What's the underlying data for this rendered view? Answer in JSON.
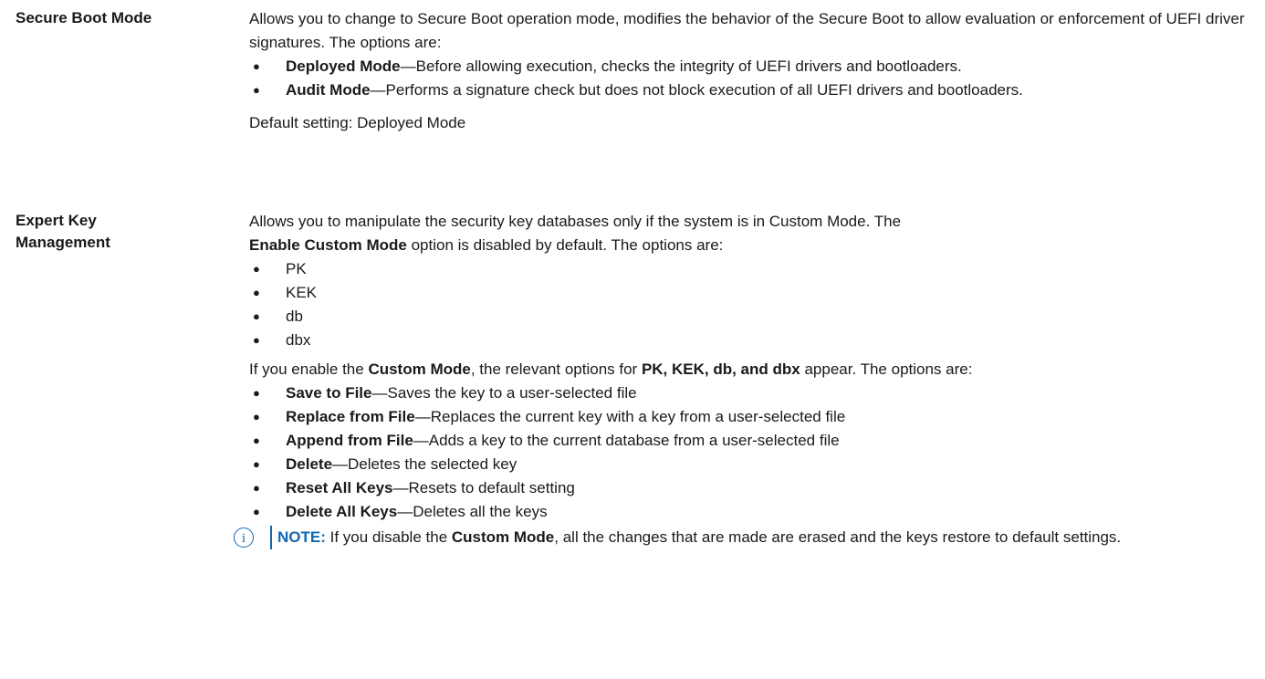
{
  "secure_boot": {
    "term": "Secure Boot Mode",
    "intro": "Allows you to change to Secure Boot operation mode, modifies the behavior of the Secure Boot to allow evaluation or enforcement of UEFI driver signatures. The options are:",
    "options": [
      {
        "name": "Deployed Mode",
        "desc": "—Before allowing execution, checks the integrity of UEFI drivers and bootloaders."
      },
      {
        "name": "Audit Mode",
        "desc": "—Performs a signature check but does not block execution of all UEFI drivers and bootloaders."
      }
    ],
    "default": "Default setting: Deployed Mode"
  },
  "expert_key": {
    "term_line1": "Expert Key",
    "term_line2": "Management",
    "intro_1": "Allows you to manipulate the security key databases only if the system is in Custom Mode. The",
    "intro_bold": "Enable Custom Mode",
    "intro_2": " option is disabled by default. The options are:",
    "keys": [
      "PK",
      "KEK",
      "db",
      "dbx"
    ],
    "enable_1": "If you enable the ",
    "enable_bold1": "Custom Mode",
    "enable_2": ", the relevant options for ",
    "enable_bold2": "PK, KEK, db, and dbx",
    "enable_3": " appear. The options are:",
    "options": [
      {
        "name": "Save to File",
        "desc": "—Saves the key to a user-selected file"
      },
      {
        "name": "Replace from File",
        "desc": "—Replaces the current key with a key from a user-selected file"
      },
      {
        "name": "Append from File",
        "desc": "—Adds a key to the current database from a user-selected file"
      },
      {
        "name": "Delete",
        "desc": "—Deletes the selected key"
      },
      {
        "name": "Reset All Keys",
        "desc": "—Resets to default setting"
      },
      {
        "name": "Delete All Keys",
        "desc": "—Deletes all the keys"
      }
    ],
    "note": {
      "icon": "info-icon",
      "label": "NOTE:",
      "text_1": " If you disable the ",
      "bold": "Custom Mode",
      "text_2": ", all the changes that are made are erased and the keys restore to default settings."
    }
  },
  "bullet_glyph": "●",
  "colors": {
    "accent": "#1268b3",
    "text": "#1a1a1a"
  }
}
